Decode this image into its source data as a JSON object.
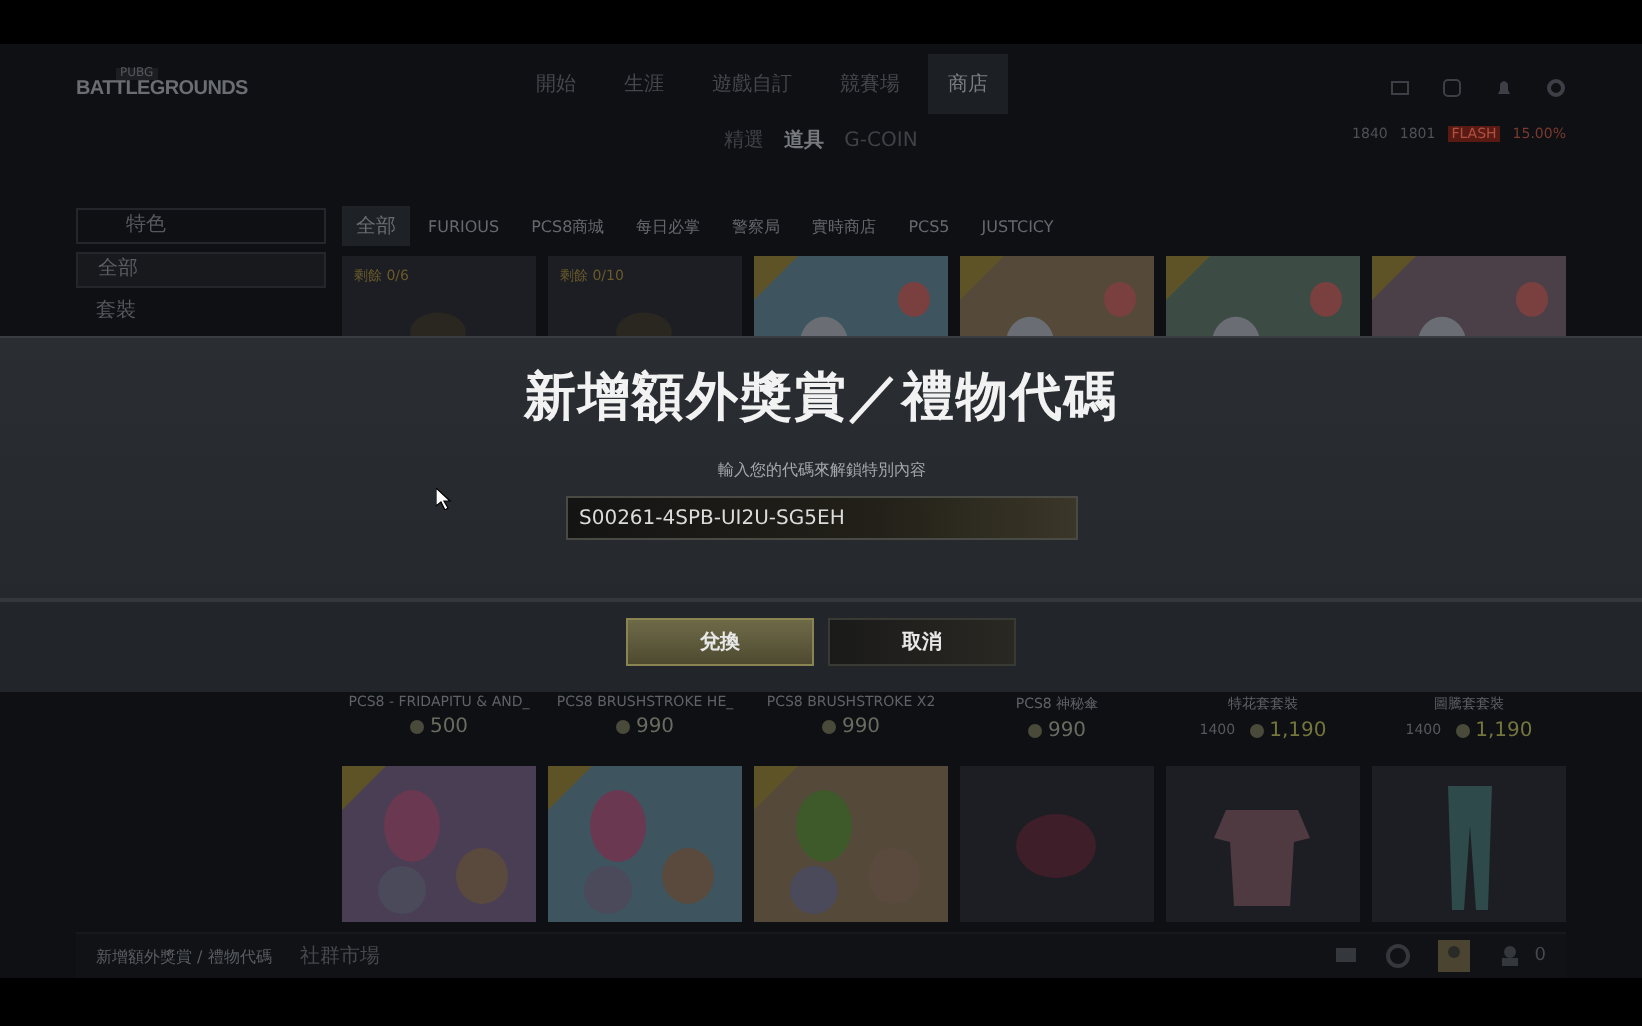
{
  "header": {
    "logo_top": "PUBG",
    "logo": "BATTLEGROUNDS",
    "nav": [
      {
        "label": "開始",
        "selected": false
      },
      {
        "label": "生涯",
        "selected": false
      },
      {
        "label": "遊戲自訂",
        "selected": false
      },
      {
        "label": "競賽場",
        "selected": false
      },
      {
        "label": "商店",
        "selected": true
      }
    ],
    "currency": [
      "1840",
      "1801"
    ],
    "sale_badge": "FLASH",
    "sale_text": "15.00%"
  },
  "subtabs": [
    {
      "label": "精選",
      "selected": false
    },
    {
      "label": "道具",
      "selected": true
    },
    {
      "label": "G-COIN",
      "selected": false
    }
  ],
  "filter": {
    "value": "特色"
  },
  "categories": [
    {
      "label": "全部",
      "selected": true
    },
    {
      "label": "FURIOUS",
      "selected": false
    },
    {
      "label": "PCS8商城",
      "selected": false
    },
    {
      "label": "每日必掌",
      "selected": false
    },
    {
      "label": "警察局",
      "selected": false
    },
    {
      "label": "實時商店",
      "selected": false
    },
    {
      "label": "PCS5",
      "selected": false
    },
    {
      "label": "JUSTCICY",
      "selected": false
    }
  ],
  "sidebar": [
    {
      "label": "全部",
      "selected": true
    },
    {
      "label": "套裝",
      "selected": false
    }
  ],
  "cards": [
    {
      "kind": "item",
      "tag": "剩餘 0/6",
      "badge": false,
      "name": "PCS8 - FRIDAPITU & AND_",
      "price": "500"
    },
    {
      "kind": "item",
      "tag": "剩餘 0/10",
      "badge": false,
      "name": "PCS8 BRUSHSTROKE HE_",
      "price": "990"
    },
    {
      "kind": "promo",
      "badge": true,
      "name": "PCS8 BRUSHSTROKE X2",
      "price": "990"
    },
    {
      "kind": "promo",
      "badge": true,
      "name": "PCS8 神秘傘",
      "price": "990"
    },
    {
      "kind": "promo",
      "badge": true,
      "name": "特花套套裝",
      "old_price": "1400",
      "price": "1,190"
    },
    {
      "kind": "promo",
      "badge": true,
      "name": "圖騰套套裝",
      "old_price": "1400",
      "price": "1,190"
    },
    {
      "kind": "promo",
      "badge": true
    },
    {
      "kind": "promo",
      "badge": true
    },
    {
      "kind": "promo",
      "badge": true
    },
    {
      "kind": "item",
      "badge": false
    },
    {
      "kind": "item",
      "badge": false
    },
    {
      "kind": "item",
      "badge": false
    }
  ],
  "dialog": {
    "title": "新增額外獎賞／禮物代碼",
    "subtitle": "輸入您的代碼來解鎖特別內容",
    "code": "S00261-4SPB-UI2U-SG5EH",
    "buttons": [
      {
        "label": "兌換",
        "kind": "primary"
      },
      {
        "label": "取消",
        "kind": "secondary"
      }
    ]
  },
  "footer": {
    "left": "新增額外獎賞 / 禮物代碼",
    "market": "社群市場",
    "friends": "0"
  }
}
